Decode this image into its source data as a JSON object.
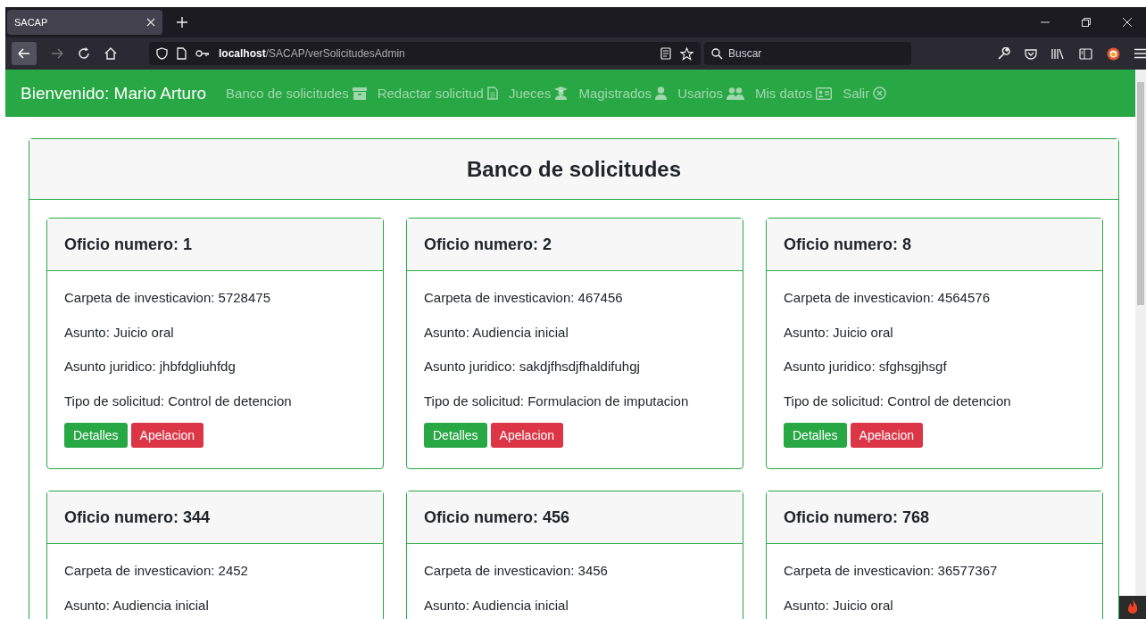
{
  "browser": {
    "tab_title": "SACAP",
    "url_host": "localhost",
    "url_path": "/SACAP/verSolicitudesAdmin",
    "search_placeholder": "Buscar"
  },
  "navbar": {
    "brand": "Bienvenido: Mario Arturo",
    "items": [
      {
        "label": "Banco de solicitudes"
      },
      {
        "label": "Redactar solicitud"
      },
      {
        "label": "Jueces"
      },
      {
        "label": "Magistrados"
      },
      {
        "label": "Usarios"
      },
      {
        "label": "Mis datos"
      },
      {
        "label": "Salir"
      }
    ]
  },
  "panel": {
    "title": "Banco de solicitudes",
    "cards": [
      {
        "title": "Oficio numero: 1",
        "fields": [
          "Carpeta de investicavion: 5728475",
          "Asunto: Juicio oral",
          "Asunto juridico: jhbfdgliuhfdg",
          "Tipo de solicitud: Control de detencion"
        ],
        "buttons": [
          {
            "label": "Detalles",
            "kind": "success"
          },
          {
            "label": "Apelacion",
            "kind": "danger"
          }
        ]
      },
      {
        "title": "Oficio numero: 2",
        "fields": [
          "Carpeta de investicavion: 467456",
          "Asunto: Audiencia inicial",
          "Asunto juridico: sakdjfhsdjfhaldifuhgj",
          "Tipo de solicitud: Formulacion de imputacion"
        ],
        "buttons": [
          {
            "label": "Detalles",
            "kind": "success"
          },
          {
            "label": "Apelacion",
            "kind": "danger"
          }
        ]
      },
      {
        "title": "Oficio numero: 8",
        "fields": [
          "Carpeta de investicavion: 4564576",
          "Asunto: Juicio oral",
          "Asunto juridico: sfghsgjhsgf",
          "Tipo de solicitud: Control de detencion"
        ],
        "buttons": [
          {
            "label": "Detalles",
            "kind": "success"
          },
          {
            "label": "Apelacion",
            "kind": "danger"
          }
        ]
      },
      {
        "title": "Oficio numero: 344",
        "fields": [
          "Carpeta de investicavion: 2452",
          "Asunto: Audiencia inicial"
        ]
      },
      {
        "title": "Oficio numero: 456",
        "fields": [
          "Carpeta de investicavion: 3456",
          "Asunto: Audiencia inicial"
        ]
      },
      {
        "title": "Oficio numero: 768",
        "fields": [
          "Carpeta de investicavion: 36577367",
          "Asunto: Juicio oral"
        ]
      }
    ]
  }
}
